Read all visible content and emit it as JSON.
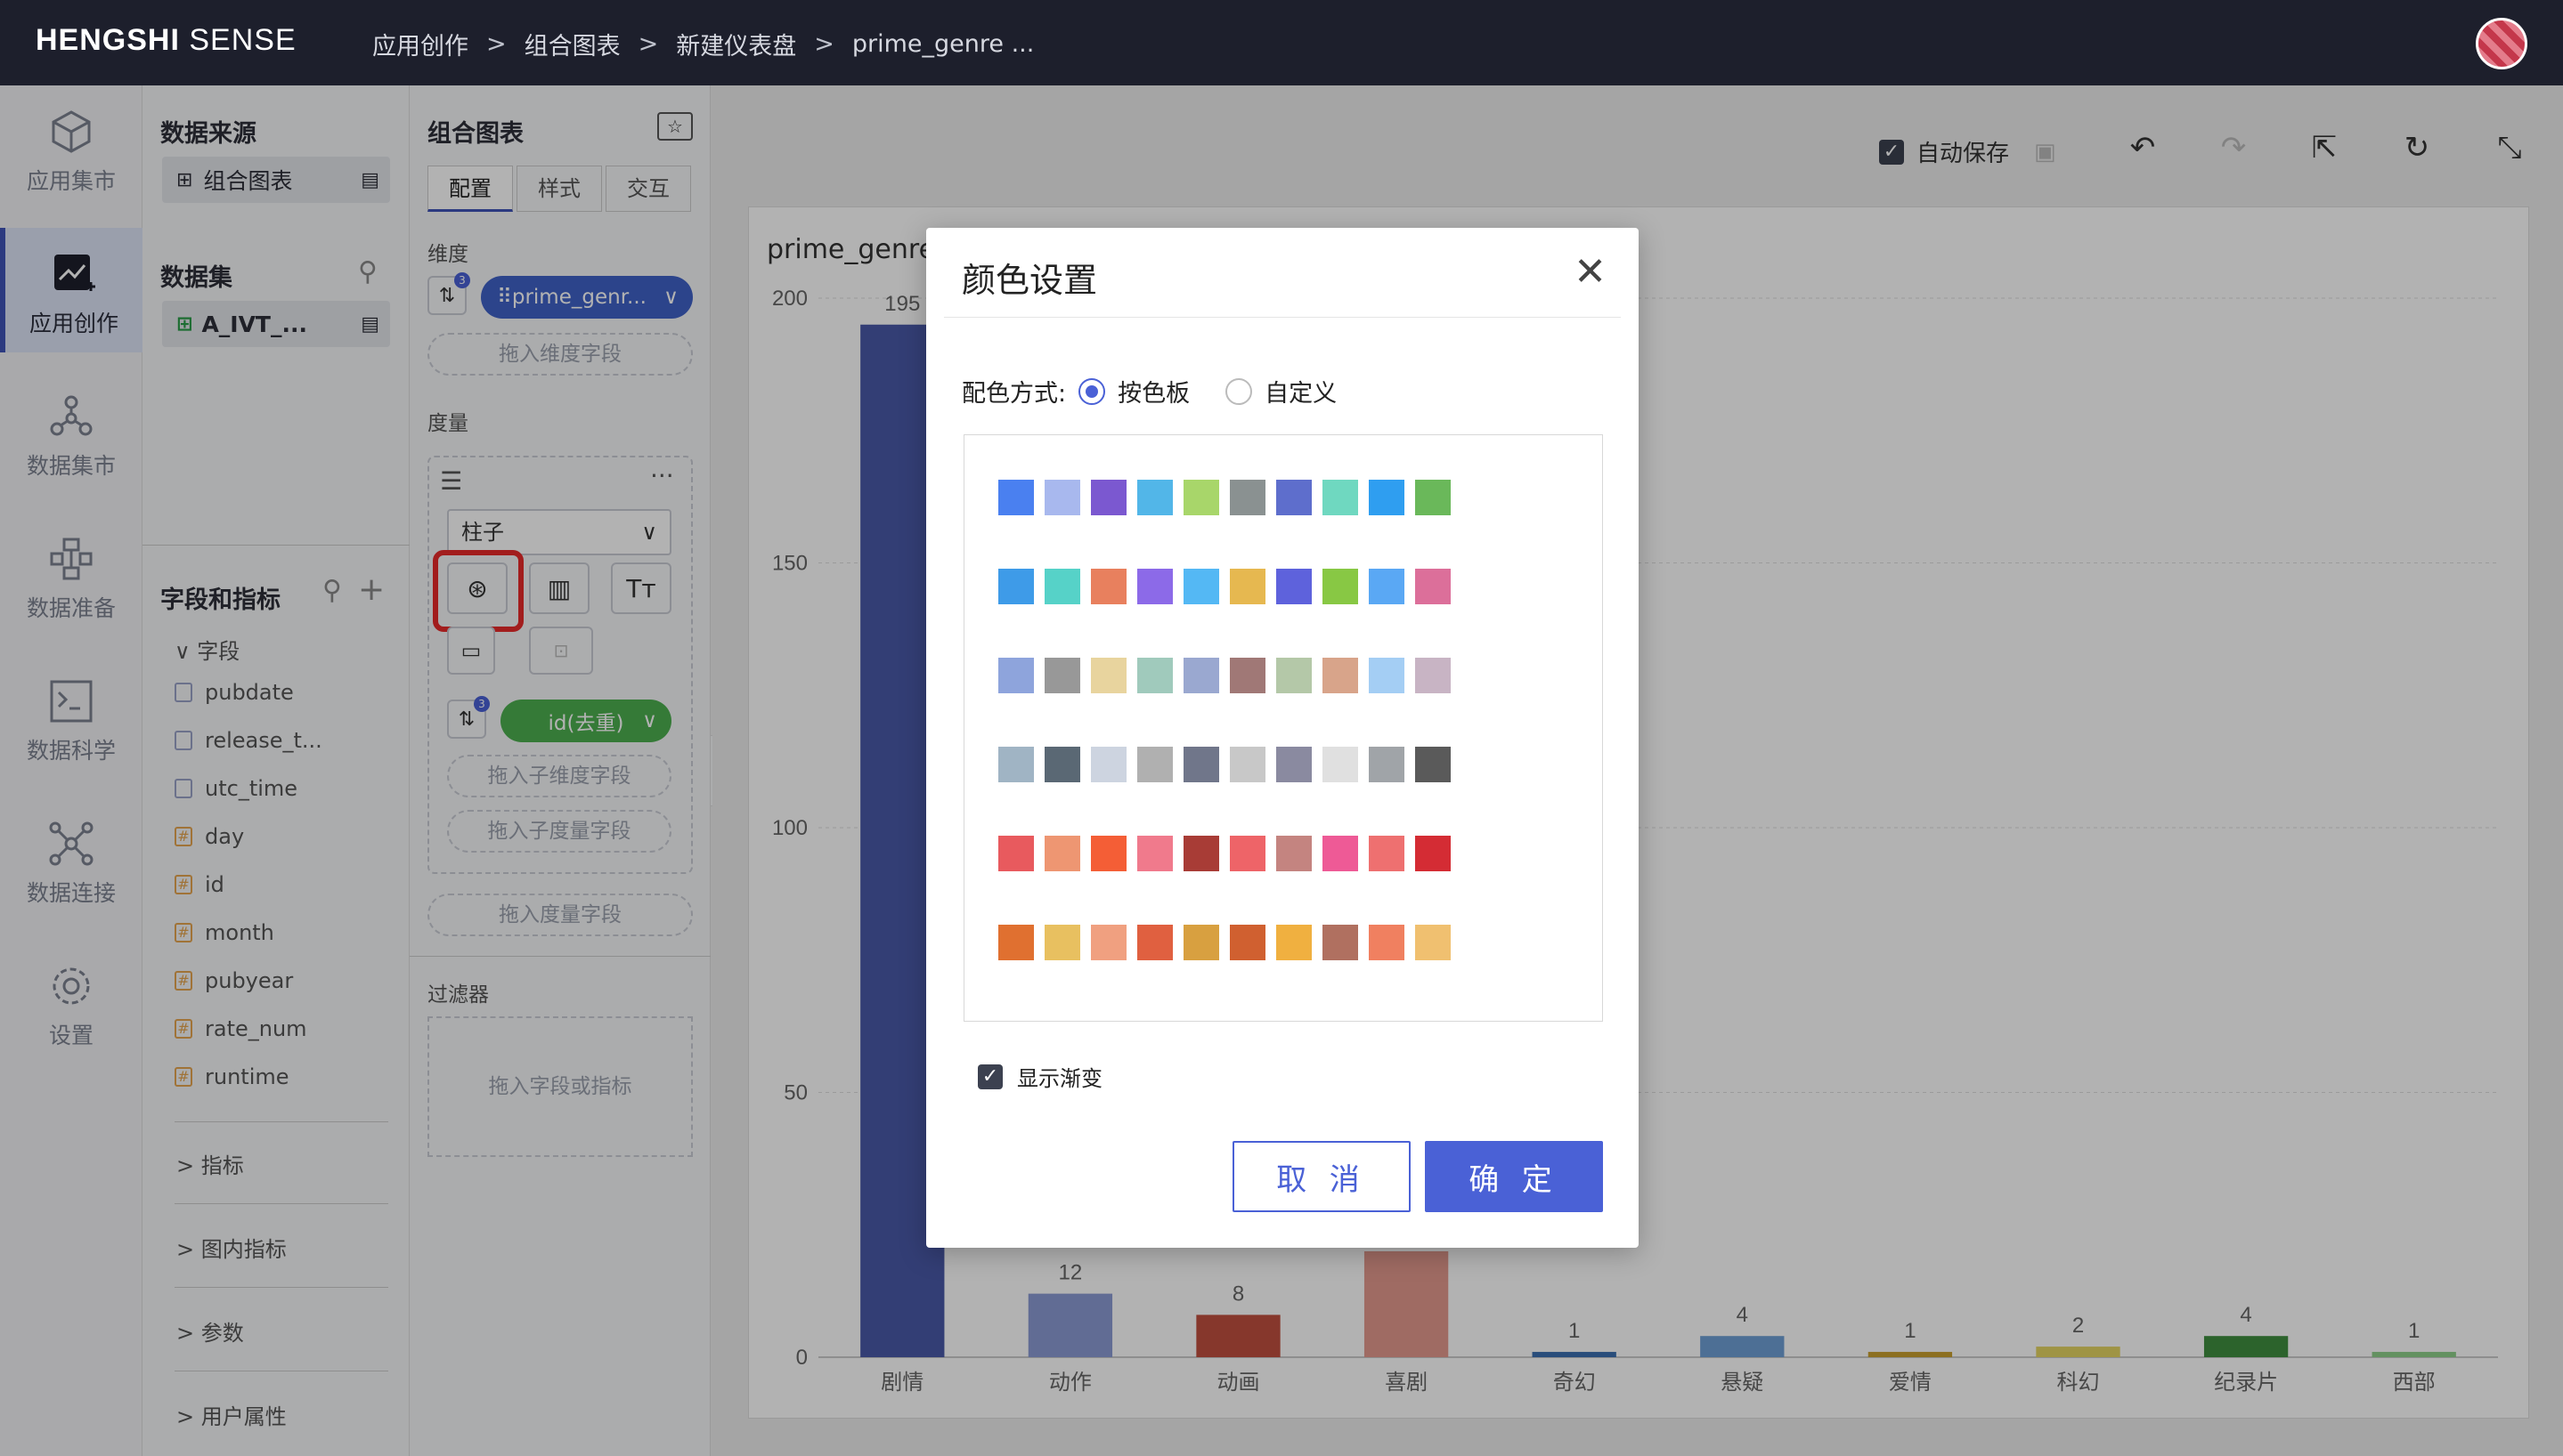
{
  "app": {
    "logo_bold": "HENGSHI",
    "logo_rest": " SENSE"
  },
  "breadcrumb": [
    "应用创作",
    "组合图表",
    "新建仪表盘",
    "prime_genre ..."
  ],
  "nav": [
    {
      "label": "应用集市",
      "icon": "cube-icon"
    },
    {
      "label": "应用创作",
      "icon": "chart-edit-icon",
      "active": true
    },
    {
      "label": "数据集市",
      "icon": "network-icon"
    },
    {
      "label": "数据准备",
      "icon": "data-prep-icon"
    },
    {
      "label": "数据科学",
      "icon": "terminal-icon"
    },
    {
      "label": "数据连接",
      "icon": "connect-icon"
    },
    {
      "label": "设置",
      "icon": "gear-icon"
    }
  ],
  "source": {
    "title": "数据来源",
    "chart_chip": "组合图表",
    "dataset_title": "数据集",
    "dataset_chip": "A_IVT_...",
    "fields_title": "字段和指标",
    "fields_group": "字段",
    "fields": [
      {
        "name": "pubdate",
        "type": "date"
      },
      {
        "name": "release_t...",
        "type": "date"
      },
      {
        "name": "utc_time",
        "type": "date"
      },
      {
        "name": "day",
        "type": "num"
      },
      {
        "name": "id",
        "type": "num"
      },
      {
        "name": "month",
        "type": "num"
      },
      {
        "name": "pubyear",
        "type": "num"
      },
      {
        "name": "rate_num",
        "type": "num"
      },
      {
        "name": "runtime",
        "type": "num"
      }
    ],
    "sections": [
      "指标",
      "图内指标",
      "参数",
      "用户属性"
    ]
  },
  "config": {
    "title": "组合图表",
    "tabs": [
      "配置",
      "样式",
      "交互"
    ],
    "dimension_label": "维度",
    "dimension_pill": "prime_genr...",
    "dimension_badge": "3",
    "drop_dimension": "拖入维度字段",
    "measure_label": "度量",
    "chart_type": "柱子",
    "measure_pill": "id(去重)",
    "measure_badge": "3",
    "drop_sub_dimension": "拖入子维度字段",
    "drop_sub_measure": "拖入子度量字段",
    "drop_measure": "拖入度量字段",
    "filter_label": "过滤器",
    "drop_filter": "拖入字段或指标"
  },
  "toolbar": {
    "autosave": "自动保存"
  },
  "chart_data": {
    "type": "bar",
    "title": "prime_genre",
    "categories": [
      "剧情",
      "动作",
      "动画",
      "喜剧",
      "奇幻",
      "悬疑",
      "爱情",
      "科幻",
      "纪录片",
      "西部"
    ],
    "values": [
      195,
      12,
      8,
      20,
      1,
      4,
      1,
      2,
      4,
      1
    ],
    "labels": [
      "195",
      "12",
      "8",
      "",
      "1",
      "4",
      "1",
      "2",
      "4",
      "1"
    ],
    "colors": [
      "#4a5aa8",
      "#8c9bd4",
      "#c0503f",
      "#e49a8e",
      "#3b6fb0",
      "#6f9fd6",
      "#c9a030",
      "#e4d462",
      "#3f8f3f",
      "#8ed08a"
    ],
    "yticks": [
      0,
      50,
      100,
      150,
      200
    ],
    "ylim": [
      0,
      200
    ]
  },
  "dialog": {
    "title": "颜色设置",
    "mode_label": "配色方式:",
    "option_palette": "按色板",
    "option_custom": "自定义",
    "gradient_label": "显示渐变",
    "cancel": "取 消",
    "ok": "确 定",
    "palettes": [
      [
        "#4a80f0",
        "#a8b8ee",
        "#7b58d0",
        "#52b6e8",
        "#a8d66a",
        "#8a9191",
        "#5e6ecc",
        "#6fd8c0",
        "#2f9ef0",
        "#6ab85a"
      ],
      [
        "#3e9be8",
        "#56d2c8",
        "#e8805e",
        "#8c6ae8",
        "#54b8f4",
        "#e6b850",
        "#5e62dc",
        "#88c844",
        "#5aa8f4",
        "#dc6f9a"
      ],
      [
        "#8ea4dc",
        "#989898",
        "#e8d49e",
        "#a0cabc",
        "#9aa8d0",
        "#a07876",
        "#b4c8a8",
        "#d8a48a",
        "#a4cef4",
        "#c8b4c4"
      ],
      [
        "#a0b4c4",
        "#5a6874",
        "#cdd4e0",
        "#b0b0b0",
        "#70768a",
        "#c8c8c8",
        "#8a8aa0",
        "#e0e0e0",
        "#a0a4a8",
        "#5a5a5a"
      ],
      [
        "#e85a5e",
        "#ee9672",
        "#f45e36",
        "#f07a8c",
        "#a83c36",
        "#ee6468",
        "#c48480",
        "#ee5a96",
        "#ee7070",
        "#d42c34"
      ],
      [
        "#e07030",
        "#e8c060",
        "#f0a080",
        "#e06040",
        "#d8a040",
        "#d06030",
        "#f0b040",
        "#b07060",
        "#f08060",
        "#f0c070"
      ]
    ]
  }
}
